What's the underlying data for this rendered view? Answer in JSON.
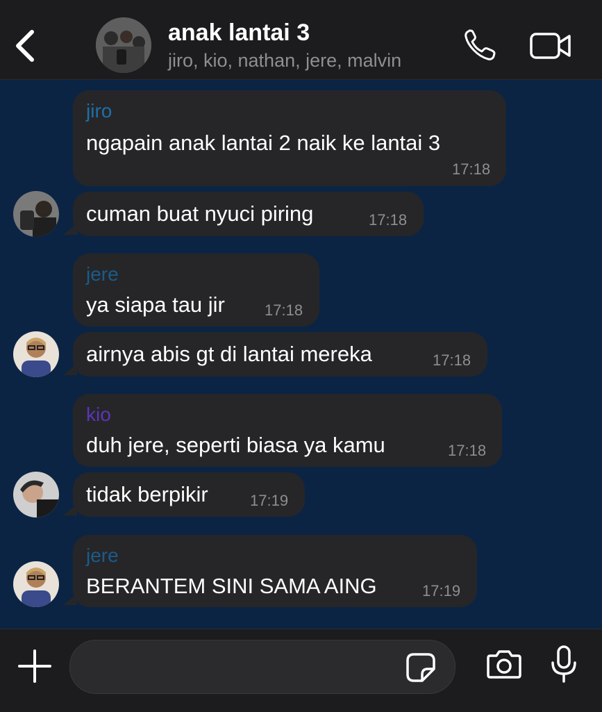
{
  "header": {
    "title": "anak lantai 3",
    "members": "jiro, kio, nathan, jere, malvin"
  },
  "colors": {
    "jiro": "#1e6fa8",
    "jere": "#1a5b8c",
    "kio": "#5a36b8",
    "bubble": "#262628",
    "chat_bg": "#0b2444"
  },
  "messages": [
    {
      "sender": "jiro",
      "text": "ngapain anak lantai 2 naik ke lantai 3",
      "time": "17:18"
    },
    {
      "text": "cuman buat nyuci piring",
      "time": "17:18"
    },
    {
      "sender": "jere",
      "text": "ya siapa tau jir",
      "time": "17:18"
    },
    {
      "text": "airnya abis gt di lantai mereka",
      "time": "17:18"
    },
    {
      "sender": "kio",
      "text": "duh jere, seperti biasa ya kamu",
      "time": "17:18"
    },
    {
      "text": "tidak berpikir",
      "time": "17:19"
    },
    {
      "sender": "jere",
      "text": "BERANTEM SINI SAMA AING",
      "time": "17:19"
    }
  ],
  "composer": {
    "placeholder": "",
    "icons": [
      "plus-icon",
      "sticker-icon",
      "camera-icon",
      "microphone-icon"
    ]
  }
}
